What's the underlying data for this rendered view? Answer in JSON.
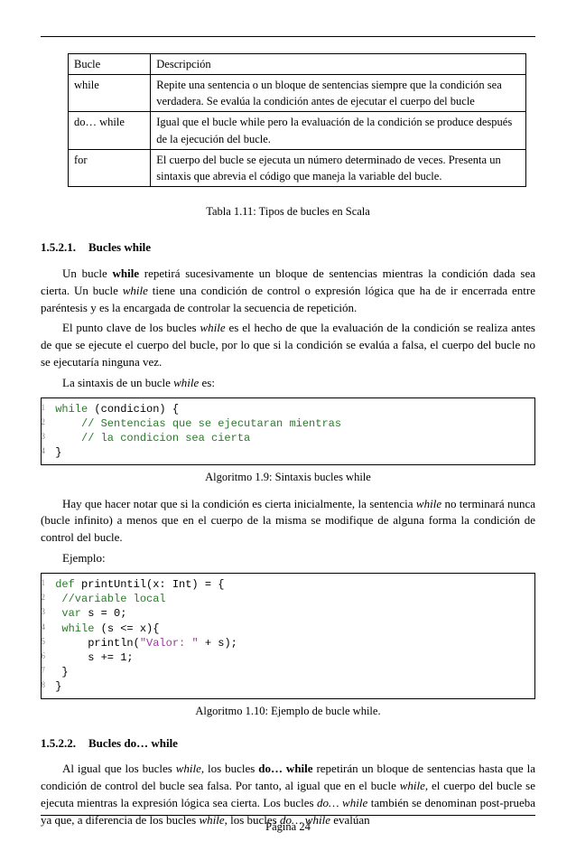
{
  "table": {
    "headers": {
      "col1": "Bucle",
      "col2": "Descripción"
    },
    "rows": [
      {
        "loop": "while",
        "desc": "Repite una sentencia o un bloque de sentencias siempre que la condición sea verdadera. Se evalúa la condición antes de ejecutar el cuerpo del bucle"
      },
      {
        "loop": "do… while",
        "desc": "Igual que el bucle while pero la evaluación de la condición se produce después de la ejecución del bucle."
      },
      {
        "loop": "for",
        "desc": "El cuerpo del bucle se ejecuta un número determinado de veces. Presenta un sintaxis que abrevia el código que maneja la variable del bucle."
      }
    ],
    "caption": "Tabla 1.11: Tipos de bucles en Scala"
  },
  "sec1": {
    "num": "1.5.2.1.",
    "title": "Bucles while",
    "p1a": "Un bucle ",
    "p1b": "while",
    "p1c": " repetirá sucesivamente un bloque de sentencias mientras la condición dada sea cierta. Un bucle ",
    "p1d": "while",
    "p1e": " tiene una condición de control o expresión lógica que ha de ir encerrada entre paréntesis y es la encargada de controlar la secuencia de repetición.",
    "p2a": "El punto clave de los bucles ",
    "p2b": "while",
    "p2c": " es el hecho de que la evaluación de la condición se realiza antes de que se ejecute el cuerpo del bucle, por lo que si la condición se evalúa a falsa, el cuerpo del bucle no se ejecutaría ninguna vez.",
    "p3a": "La sintaxis de un bucle ",
    "p3b": "while",
    "p3c": " es:"
  },
  "code1": {
    "l1": {
      "n": "1",
      "kw": "while",
      "rest": " (condicion) {"
    },
    "l2": {
      "n": "2",
      "txt": "     // Sentencias que se ejecutaran mientras"
    },
    "l3": {
      "n": "3",
      "txt": "     // la condicion sea cierta"
    },
    "l4": {
      "n": "4",
      "txt": " }"
    },
    "caption": "Algoritmo 1.9: Sintaxis bucles while"
  },
  "mid": {
    "p1a": "Hay que hacer notar que si la condición es cierta inicialmente, la sentencia ",
    "p1b": "while",
    "p1c": " no terminará nunca (bucle infinito) a menos que en el cuerpo de la misma se modifique de alguna forma la condición de control del bucle.",
    "p2": "Ejemplo:"
  },
  "code2": {
    "l1": {
      "n": "1",
      "kw": "def",
      "rest": " printUntil(x: Int) = {"
    },
    "l2": {
      "n": "2",
      "txt": "  //variable local"
    },
    "l3": {
      "n": "3",
      "kw": "  var",
      "rest": " s = 0;"
    },
    "l4": {
      "n": "4",
      "kw": "  while",
      "rest": " (s <= x){"
    },
    "l5": {
      "n": "5",
      "pre": "      println(",
      "str": "\"Valor: \"",
      "post": " + s);"
    },
    "l6": {
      "n": "6",
      "txt": "      s += 1;"
    },
    "l7": {
      "n": "7",
      "txt": "  }"
    },
    "l8": {
      "n": "8",
      "txt": " }"
    },
    "caption": "Algoritmo 1.10: Ejemplo de bucle while."
  },
  "sec2": {
    "num": "1.5.2.2.",
    "title": "Bucles do… while",
    "p1a": "Al igual que los bucles ",
    "p1b": "while",
    "p1c": ", los bucles ",
    "p1d": "do… while",
    "p1e": " repetirán un bloque de sentencias hasta que la condición de control del bucle sea falsa. Por tanto, al igual que en el bucle ",
    "p1f": "while",
    "p1g": ", el cuerpo del bucle se ejecuta mientras la expresión lógica sea cierta. Los bucles ",
    "p1h": "do… while",
    "p1i": " también se denominan post-prueba ya que, a diferencia de los bucles ",
    "p1j": "while",
    "p1k": ", los bucles ",
    "p1l": "do… while",
    "p1m": " evalúan"
  },
  "footer": {
    "page": "Página 24"
  }
}
